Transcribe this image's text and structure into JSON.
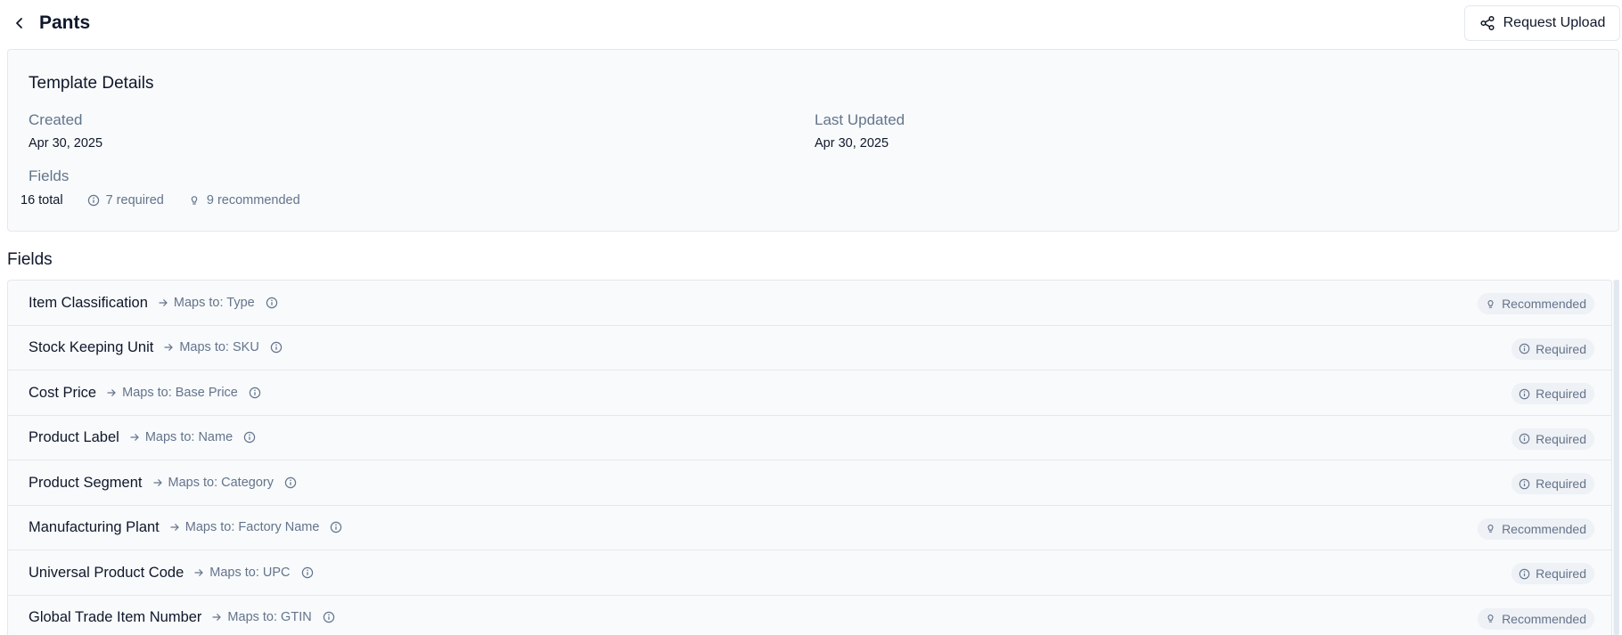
{
  "header": {
    "title": "Pants",
    "request_upload_label": "Request Upload"
  },
  "template_details": {
    "title": "Template Details",
    "created_label": "Created",
    "created_value": "Apr 30, 2025",
    "updated_label": "Last Updated",
    "updated_value": "Apr 30, 2025",
    "fields_label": "Fields",
    "fields_total": "16 total",
    "fields_required": "7 required",
    "fields_recommended": "9 recommended"
  },
  "fields_section": {
    "title": "Fields",
    "rows": [
      {
        "name": "Item Classification",
        "maps_to": "Maps to: Type",
        "badge": "Recommended"
      },
      {
        "name": "Stock Keeping Unit",
        "maps_to": "Maps to: SKU",
        "badge": "Required"
      },
      {
        "name": "Cost Price",
        "maps_to": "Maps to: Base Price",
        "badge": "Required"
      },
      {
        "name": "Product Label",
        "maps_to": "Maps to: Name",
        "badge": "Required"
      },
      {
        "name": "Product Segment",
        "maps_to": "Maps to: Category",
        "badge": "Required"
      },
      {
        "name": "Manufacturing Plant",
        "maps_to": "Maps to: Factory Name",
        "badge": "Recommended"
      },
      {
        "name": "Universal Product Code",
        "maps_to": "Maps to: UPC",
        "badge": "Required"
      },
      {
        "name": "Global Trade Item Number",
        "maps_to": "Maps to: GTIN",
        "badge": "Recommended"
      }
    ]
  },
  "colors": {
    "text_primary": "#0f172a",
    "text_muted": "#64748b",
    "card_background": "#f8fafc",
    "border": "#e5e7eb",
    "badge_background": "#eef1f5"
  }
}
